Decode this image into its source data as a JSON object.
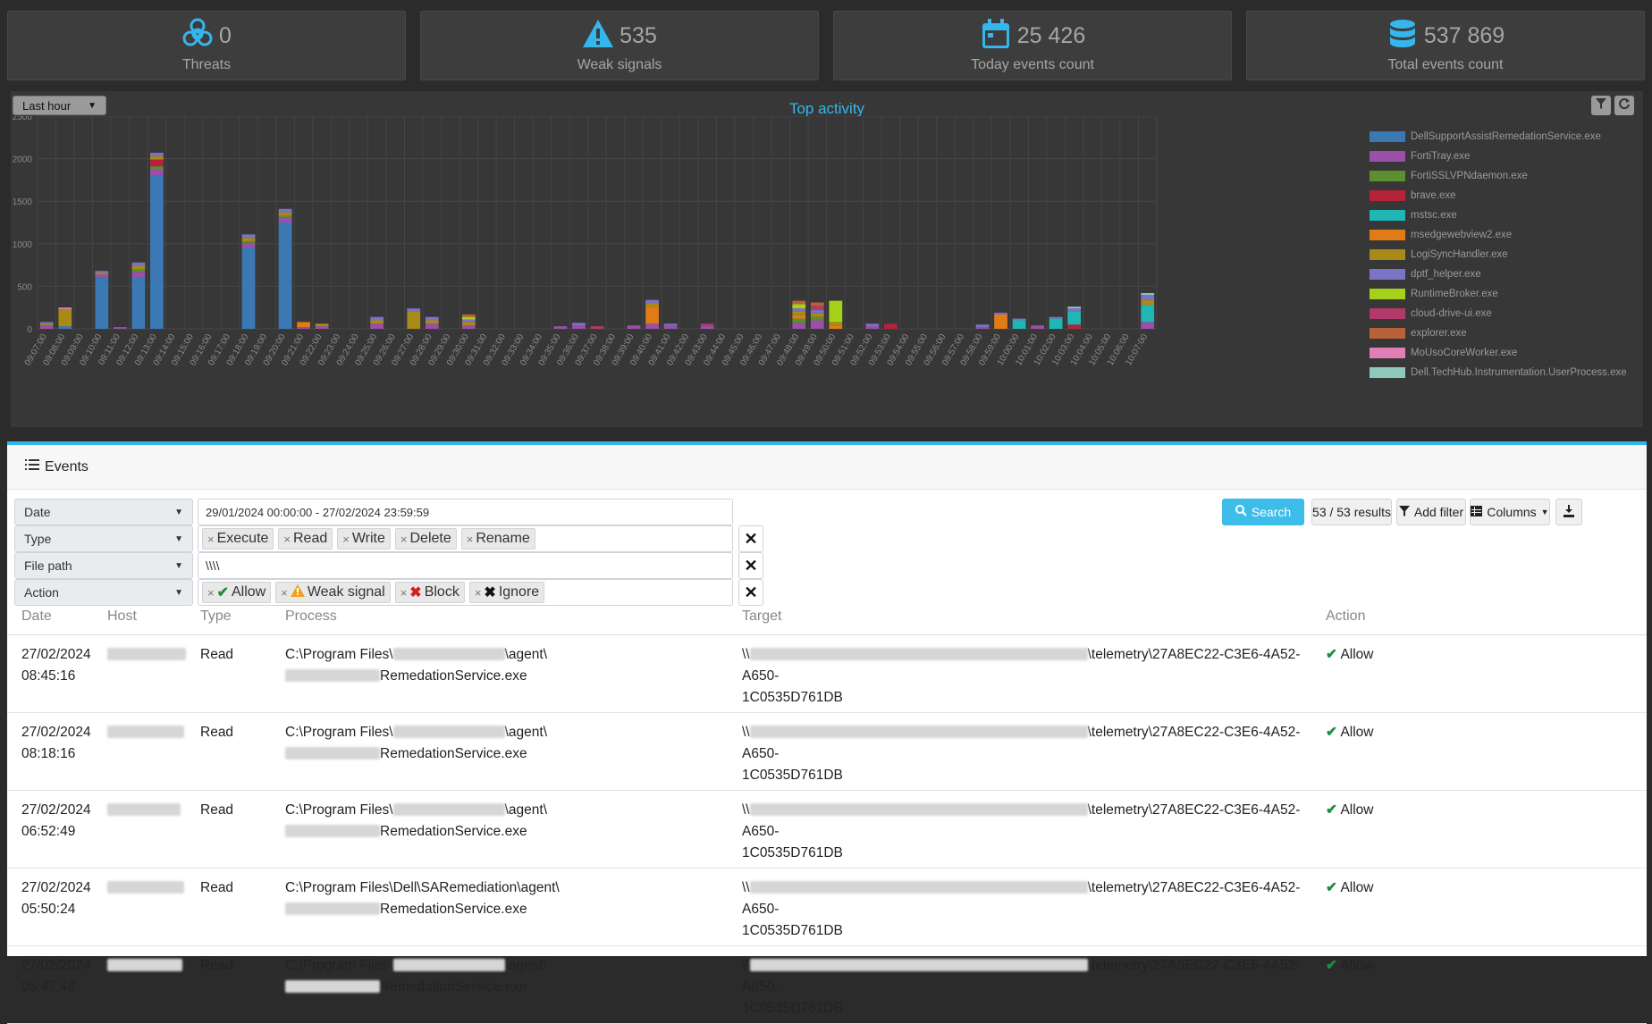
{
  "stats": [
    {
      "value": "0",
      "label": "Threats",
      "icon": "biohazard-icon"
    },
    {
      "value": "535",
      "label": "Weak signals",
      "icon": "warning-icon"
    },
    {
      "value": "25 426",
      "label": "Today events count",
      "icon": "calendar-icon"
    },
    {
      "value": "537 869",
      "label": "Total events count",
      "icon": "database-icon"
    }
  ],
  "chart_panel": {
    "period": "Last hour",
    "title": "Top activity"
  },
  "chart_data": {
    "type": "bar",
    "stacked": true,
    "title": "Top activity",
    "ylim": [
      0,
      2500
    ],
    "yticks": [
      0,
      500,
      1000,
      1500,
      2000,
      2500
    ],
    "grid": true,
    "legend_placement": "right",
    "categories": [
      "09:07:00",
      "09:08:00",
      "09:09:00",
      "09:10:00",
      "09:11:00",
      "09:12:00",
      "09:13:00",
      "09:14:00",
      "09:15:00",
      "09:16:00",
      "09:17:00",
      "09:18:00",
      "09:19:00",
      "09:20:00",
      "09:21:00",
      "09:22:00",
      "09:23:00",
      "09:24:00",
      "09:25:00",
      "09:26:00",
      "09:27:00",
      "09:28:00",
      "09:29:00",
      "09:30:00",
      "09:31:00",
      "09:32:00",
      "09:33:00",
      "09:34:00",
      "09:35:00",
      "09:36:00",
      "09:37:00",
      "09:38:00",
      "09:39:00",
      "09:40:00",
      "09:41:00",
      "09:42:00",
      "09:43:00",
      "09:44:00",
      "09:45:00",
      "09:46:00",
      "09:47:00",
      "09:48:00",
      "09:49:00",
      "09:50:00",
      "09:51:00",
      "09:52:00",
      "09:53:00",
      "09:54:00",
      "09:55:00",
      "09:56:00",
      "09:57:00",
      "09:58:00",
      "09:59:00",
      "10:00:00",
      "10:01:00",
      "10:02:00",
      "10:03:00",
      "10:04:00",
      "10:05:00",
      "10:06:00",
      "10:07:00"
    ],
    "series": [
      {
        "name": "DellSupportAssistRemedationService.exe",
        "color": "#3a79b4",
        "values": [
          0,
          30,
          0,
          600,
          0,
          600,
          1800,
          0,
          0,
          0,
          0,
          950,
          0,
          1250,
          0,
          0,
          0,
          0,
          0,
          0,
          0,
          0,
          0,
          0,
          0,
          0,
          0,
          0,
          0,
          0,
          0,
          0,
          0,
          0,
          0,
          0,
          0,
          0,
          0,
          0,
          0,
          0,
          0,
          0,
          0,
          0,
          0,
          0,
          0,
          0,
          0,
          0,
          0,
          0,
          0,
          0,
          0,
          0,
          0,
          0,
          0
        ]
      },
      {
        "name": "FortiTray.exe",
        "color": "#9b4fa8",
        "values": [
          40,
          0,
          0,
          40,
          20,
          70,
          80,
          0,
          0,
          0,
          0,
          60,
          0,
          60,
          20,
          30,
          0,
          0,
          60,
          0,
          0,
          60,
          0,
          40,
          0,
          0,
          0,
          0,
          30,
          40,
          0,
          0,
          40,
          60,
          40,
          0,
          30,
          0,
          0,
          0,
          0,
          70,
          100,
          0,
          0,
          30,
          0,
          0,
          0,
          0,
          0,
          20,
          0,
          0,
          40,
          0,
          0,
          0,
          0,
          0,
          80
        ]
      },
      {
        "name": "FortiSSLVPNdaemon.exe",
        "color": "#5b8f2f",
        "values": [
          0,
          0,
          0,
          0,
          0,
          30,
          30,
          0,
          0,
          0,
          0,
          20,
          0,
          20,
          0,
          0,
          0,
          0,
          0,
          0,
          0,
          0,
          0,
          0,
          0,
          0,
          0,
          0,
          0,
          0,
          0,
          0,
          0,
          0,
          0,
          0,
          0,
          0,
          0,
          0,
          0,
          50,
          40,
          0,
          0,
          0,
          0,
          0,
          0,
          0,
          0,
          0,
          0,
          0,
          0,
          0,
          0,
          0,
          0,
          0,
          0
        ]
      },
      {
        "name": "brave.exe",
        "color": "#b5233a",
        "values": [
          0,
          0,
          0,
          0,
          0,
          0,
          80,
          0,
          0,
          0,
          0,
          0,
          0,
          0,
          0,
          0,
          0,
          0,
          0,
          0,
          0,
          0,
          0,
          0,
          0,
          0,
          0,
          0,
          0,
          0,
          0,
          0,
          0,
          0,
          0,
          0,
          0,
          0,
          0,
          0,
          0,
          0,
          0,
          0,
          0,
          0,
          60,
          0,
          0,
          0,
          0,
          0,
          0,
          0,
          0,
          0,
          50,
          0,
          0,
          0,
          0
        ]
      },
      {
        "name": "mstsc.exe",
        "color": "#1fb6b6",
        "values": [
          0,
          0,
          0,
          0,
          0,
          0,
          0,
          0,
          0,
          0,
          0,
          0,
          0,
          0,
          0,
          0,
          0,
          0,
          0,
          0,
          0,
          0,
          0,
          0,
          0,
          0,
          0,
          0,
          0,
          0,
          0,
          0,
          0,
          0,
          0,
          0,
          0,
          0,
          0,
          0,
          0,
          0,
          0,
          0,
          0,
          0,
          0,
          0,
          0,
          0,
          0,
          0,
          0,
          100,
          0,
          120,
          150,
          0,
          0,
          0,
          200
        ]
      },
      {
        "name": "msedgewebview2.exe",
        "color": "#e07b18",
        "values": [
          0,
          0,
          0,
          0,
          0,
          0,
          0,
          0,
          0,
          0,
          0,
          0,
          0,
          0,
          60,
          0,
          0,
          0,
          0,
          0,
          0,
          0,
          0,
          0,
          0,
          0,
          0,
          0,
          0,
          0,
          0,
          0,
          0,
          200,
          0,
          0,
          0,
          0,
          0,
          0,
          0,
          40,
          0,
          40,
          0,
          0,
          0,
          0,
          0,
          0,
          0,
          0,
          170,
          0,
          0,
          0,
          0,
          0,
          0,
          0,
          0
        ]
      },
      {
        "name": "LogiSyncHandler.exe",
        "color": "#a88a18",
        "values": [
          20,
          200,
          0,
          20,
          0,
          40,
          40,
          0,
          0,
          0,
          0,
          40,
          0,
          40,
          0,
          30,
          0,
          0,
          40,
          0,
          200,
          40,
          0,
          40,
          0,
          0,
          0,
          0,
          0,
          0,
          0,
          0,
          0,
          40,
          0,
          0,
          0,
          0,
          0,
          0,
          0,
          40,
          40,
          40,
          0,
          0,
          0,
          0,
          0,
          0,
          0,
          0,
          0,
          0,
          0,
          0,
          0,
          0,
          0,
          0,
          60
        ]
      },
      {
        "name": "dptf_helper.exe",
        "color": "#7a73c6",
        "values": [
          20,
          0,
          0,
          20,
          0,
          40,
          40,
          0,
          0,
          0,
          0,
          40,
          0,
          40,
          0,
          0,
          0,
          0,
          40,
          0,
          40,
          40,
          0,
          30,
          0,
          0,
          0,
          0,
          0,
          30,
          0,
          0,
          0,
          40,
          20,
          0,
          0,
          0,
          0,
          0,
          0,
          40,
          40,
          0,
          0,
          30,
          0,
          0,
          0,
          0,
          0,
          30,
          20,
          20,
          0,
          20,
          40,
          0,
          0,
          0,
          60
        ]
      },
      {
        "name": "RuntimeBroker.exe",
        "color": "#a6d11a",
        "values": [
          0,
          0,
          0,
          0,
          0,
          0,
          0,
          0,
          0,
          0,
          0,
          0,
          0,
          0,
          0,
          0,
          0,
          0,
          0,
          0,
          0,
          0,
          0,
          30,
          0,
          0,
          0,
          0,
          0,
          0,
          0,
          0,
          0,
          0,
          0,
          0,
          0,
          0,
          0,
          0,
          0,
          50,
          0,
          250,
          0,
          0,
          0,
          0,
          0,
          0,
          0,
          0,
          0,
          0,
          0,
          0,
          0,
          0,
          0,
          0,
          0
        ]
      },
      {
        "name": "cloud-drive-ui.exe",
        "color": "#b03a6a",
        "values": [
          0,
          0,
          0,
          0,
          0,
          0,
          0,
          0,
          0,
          0,
          0,
          0,
          0,
          0,
          0,
          0,
          0,
          0,
          0,
          0,
          0,
          0,
          0,
          0,
          0,
          0,
          0,
          0,
          0,
          0,
          30,
          0,
          0,
          0,
          0,
          0,
          30,
          0,
          0,
          0,
          0,
          0,
          50,
          0,
          0,
          0,
          0,
          0,
          0,
          0,
          0,
          0,
          0,
          0,
          0,
          0,
          0,
          0,
          0,
          0,
          0
        ]
      },
      {
        "name": "explorer.exe",
        "color": "#b7623a",
        "values": [
          0,
          0,
          0,
          0,
          0,
          0,
          0,
          0,
          0,
          0,
          0,
          0,
          0,
          0,
          0,
          0,
          0,
          0,
          0,
          0,
          0,
          0,
          0,
          30,
          0,
          0,
          0,
          0,
          0,
          0,
          0,
          0,
          0,
          0,
          0,
          0,
          0,
          0,
          0,
          0,
          0,
          40,
          40,
          0,
          0,
          0,
          0,
          0,
          0,
          0,
          0,
          0,
          0,
          0,
          0,
          0,
          0,
          0,
          0,
          0,
          0
        ]
      },
      {
        "name": "MoUsoCoreWorker.exe",
        "color": "#e07fb6",
        "values": [
          0,
          20,
          0,
          0,
          0,
          0,
          0,
          0,
          0,
          0,
          0,
          0,
          0,
          0,
          0,
          0,
          0,
          0,
          0,
          0,
          0,
          0,
          0,
          0,
          0,
          0,
          0,
          0,
          0,
          0,
          0,
          0,
          0,
          0,
          0,
          0,
          0,
          0,
          0,
          0,
          0,
          0,
          0,
          0,
          0,
          0,
          0,
          0,
          0,
          0,
          0,
          0,
          0,
          0,
          0,
          0,
          0,
          0,
          0,
          0,
          0
        ]
      },
      {
        "name": "Dell.TechHub.Instrumentation.UserProcess.exe",
        "color": "#8fc9bd",
        "values": [
          0,
          0,
          0,
          0,
          0,
          0,
          0,
          0,
          0,
          0,
          0,
          0,
          0,
          0,
          0,
          0,
          0,
          0,
          0,
          0,
          0,
          0,
          0,
          0,
          0,
          0,
          0,
          0,
          0,
          0,
          0,
          0,
          0,
          0,
          0,
          0,
          0,
          0,
          0,
          0,
          0,
          0,
          0,
          0,
          0,
          0,
          0,
          0,
          0,
          0,
          0,
          0,
          0,
          0,
          0,
          0,
          20,
          0,
          0,
          0,
          20
        ]
      }
    ]
  },
  "events": {
    "title": "Events",
    "filters": [
      {
        "field": "Date",
        "value": "29/01/2024 00:00:00 - 27/02/2024 23:59:59"
      },
      {
        "field": "Type",
        "chips": [
          "Execute",
          "Read",
          "Write",
          "Delete",
          "Rename"
        ]
      },
      {
        "field": "File path",
        "value": "\\\\\\\\"
      },
      {
        "field": "Action",
        "chips": [
          "Allow",
          "Weak signal",
          "Block",
          "Ignore"
        ]
      }
    ],
    "buttons": {
      "search": "Search",
      "results": "53 / 53 results",
      "add_filter": "Add filter",
      "columns": "Columns"
    },
    "columns": [
      "Date",
      "Host",
      "Type",
      "Process",
      "Target",
      "Action"
    ],
    "rows": [
      {
        "date": "27/02/2024",
        "time": "08:45:16",
        "type": "Read",
        "proc_prefix": "C:\\Program Files\\",
        "proc_mid": "\\agent\\",
        "proc_suffix": "RemedationService.exe",
        "target_prefix": "\\\\",
        "target_suffix": "\\telemetry\\27A8EC22-C3E6-4A52-A650-",
        "target_line2": "1C0535D761DB",
        "action": "Allow"
      },
      {
        "date": "27/02/2024",
        "time": "08:18:16",
        "type": "Read",
        "proc_prefix": "C:\\Program Files\\",
        "proc_mid": "\\agent\\",
        "proc_suffix": "RemedationService.exe",
        "target_prefix": "\\\\",
        "target_suffix": "\\telemetry\\27A8EC22-C3E6-4A52-A650-",
        "target_line2": "1C0535D761DB",
        "action": "Allow"
      },
      {
        "date": "27/02/2024",
        "time": "06:52:49",
        "type": "Read",
        "proc_prefix": "C:\\Program Files\\",
        "proc_mid": "\\agent\\",
        "proc_suffix": "RemedationService.exe",
        "target_prefix": "\\\\",
        "target_suffix": "\\telemetry\\27A8EC22-C3E6-4A52-A650-",
        "target_line2": "1C0535D761DB",
        "action": "Allow"
      },
      {
        "date": "27/02/2024",
        "time": "05:50:24",
        "type": "Read",
        "proc_prefix": "C:\\Program Files\\Dell\\SARemediation\\agent\\",
        "proc_mid": "",
        "proc_suffix": "RemedationService.exe",
        "target_prefix": "\\\\",
        "target_suffix": "\\telemetry\\27A8EC22-C3E6-4A52-A650-",
        "target_line2": "1C0535D761DB",
        "action": "Allow"
      },
      {
        "date": "27/02/2024",
        "time": "05:47:48",
        "type": "Read",
        "proc_prefix": "C:\\Program Files\\",
        "proc_mid": "\\agent\\",
        "proc_suffix": "RemedationService.exe",
        "target_prefix": "\\\\",
        "target_suffix": "\\telemetry\\27A8EC22-C3E6-4A52-A650-",
        "target_line2": "1C0535D761DB",
        "action": "Allow"
      }
    ]
  }
}
